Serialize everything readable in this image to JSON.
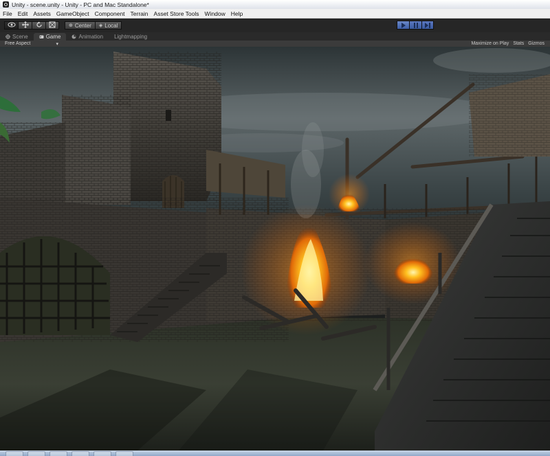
{
  "window": {
    "title": "Unity - scene.unity - Unity - PC and Mac Standalone*"
  },
  "menu": [
    "File",
    "Edit",
    "Assets",
    "GameObject",
    "Component",
    "Terrain",
    "Asset Store Tools",
    "Window",
    "Help"
  ],
  "toolbar": {
    "tools": [
      "hand-icon",
      "move-icon",
      "rotate-icon",
      "scale-icon"
    ],
    "pivot_label": "Center",
    "space_label": "Local",
    "playback": [
      "play-icon",
      "pause-icon",
      "step-icon"
    ]
  },
  "tabs": [
    {
      "label": "Scene",
      "icon": "scene-icon"
    },
    {
      "label": "Game",
      "icon": "game-icon"
    },
    {
      "label": "Animation",
      "icon": "animation-icon"
    },
    {
      "label": "Lightmapping",
      "icon": ""
    }
  ],
  "game_view": {
    "aspect": "Free Aspect",
    "maximize": "Maximize on Play",
    "stats": "Stats",
    "gizmos": "Gizmos"
  },
  "colors": {
    "play_active": "#3e5fa8",
    "fire": "#ffb020",
    "sky": "#4a5357"
  }
}
